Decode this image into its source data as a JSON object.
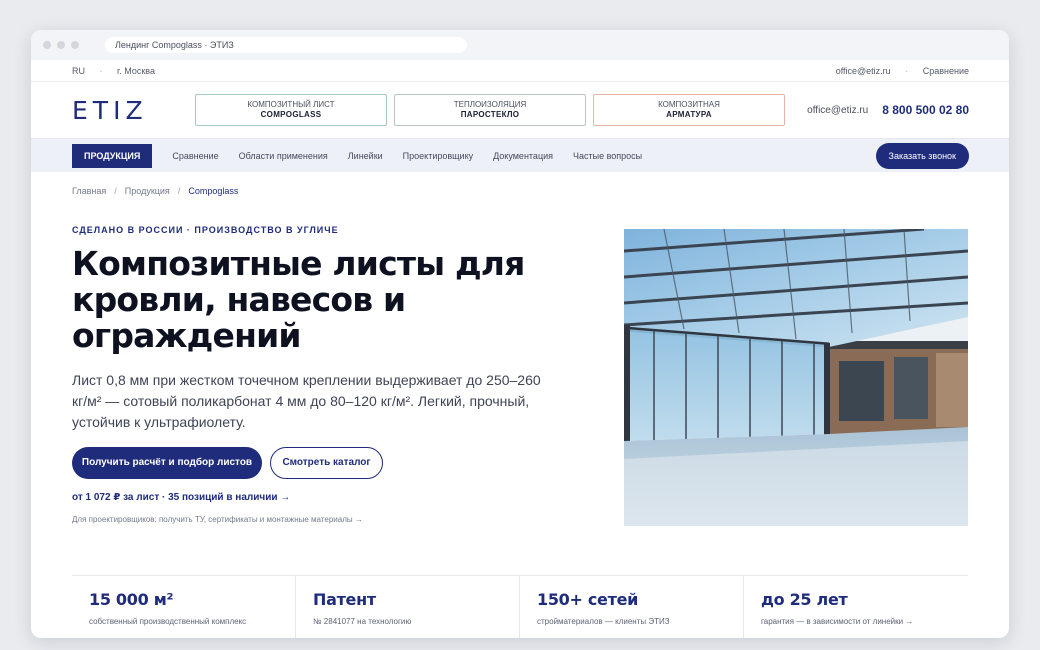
{
  "browser": {
    "tab_title": "Лендинг Compoglass · ЭТИЗ"
  },
  "topstrip": {
    "lang": "RU",
    "separator": "·",
    "city": "г. Москва",
    "email": "office@etiz.ru",
    "compare": "Сравнение"
  },
  "header": {
    "logo": "ETIZ",
    "products": [
      {
        "line1": "КОМПОЗИТНЫЙ ЛИСТ",
        "line2": "COMPOGLASS"
      },
      {
        "line1": "ТЕПЛОИЗОЛЯЦИЯ",
        "line2": "ПАРОСТЕКЛО"
      },
      {
        "line1": "КОМПОЗИТНАЯ",
        "line2": "АРМАТУРА"
      }
    ],
    "email": "office@etiz.ru",
    "phone": "8 800 500 02 80"
  },
  "nav": {
    "active": "ПРОДУКЦИЯ",
    "items": [
      "Сравнение",
      "Области применения",
      "Линейки",
      "Проектировщику",
      "Документация",
      "Частые вопросы"
    ],
    "call_button": "Заказать звонок"
  },
  "breadcrumb": {
    "items": [
      "Главная",
      "Продукция",
      "Compoglass"
    ],
    "separator": "/"
  },
  "hero": {
    "eyebrow": "СДЕЛАНО В РОССИИ · ПРОИЗВОДСТВО В УГЛИЧЕ",
    "title": "Композитные листы для кровли, навесов и ограждений",
    "description": "Лист 0,8 мм при жестком точечном креплении выдерживает до 250–260 кг/м² — сотовый поликарбонат 4 мм до 80–120 кг/м². Легкий, прочный, устойчив к ультрафиолету.",
    "primary_button": "Получить расчёт и подбор листов",
    "secondary_button": "Смотреть каталог",
    "price_line": "от 1 072 ₽ за лист · 35 позиций в наличии →",
    "designer_line": "Для проектировщиков: получить ТУ, сертификаты и монтажные материалы →"
  },
  "stats": [
    {
      "value": "15 000 м²",
      "caption": "собственный производственный комплекс"
    },
    {
      "value": "Патент",
      "caption": "№ 2841077 на технологию"
    },
    {
      "value": "150+ сетей",
      "caption": "стройматериалов — клиенты ЭТИЗ"
    },
    {
      "value": "до 25 лет",
      "caption": "гарантия — в зависимости от линейки →"
    }
  ],
  "colors": {
    "brand": "#1f2c7c",
    "nav_bg": "#eef0f8"
  }
}
